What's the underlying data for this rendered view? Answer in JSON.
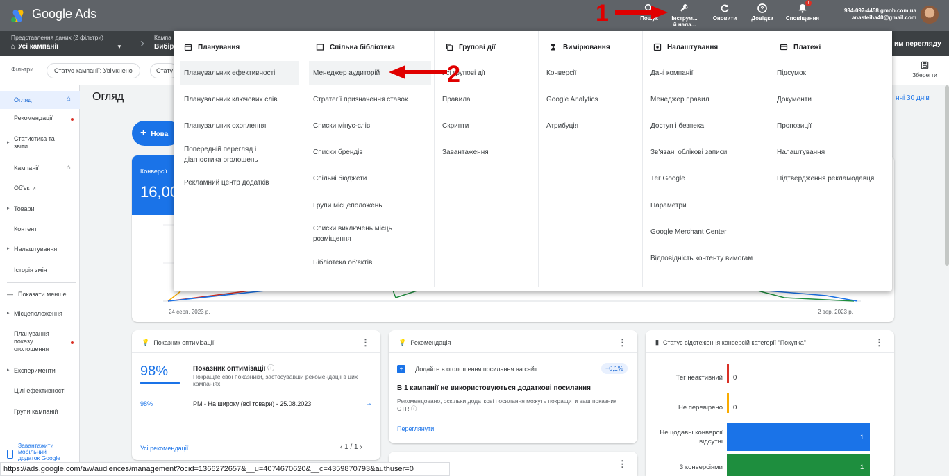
{
  "app": {
    "name": "Google Ads"
  },
  "header": {
    "tools": [
      {
        "label": "Пошук",
        "icon": "search-icon"
      },
      {
        "label": "Інструм... й нала...",
        "icon": "wrench-icon"
      },
      {
        "label": "Оновити",
        "icon": "refresh-icon"
      },
      {
        "label": "Довідка",
        "icon": "help-icon"
      },
      {
        "label": "Сповіщення",
        "icon": "bell-icon",
        "badge": "!"
      }
    ],
    "account_id": "934-097-4458 gmob.com.ua",
    "account_email": "anasteiha40@gmail.com"
  },
  "subbar": {
    "view_label": "Представлення даних (2 фільтри)",
    "view_value": "Усі кампанії",
    "campaign_label": "Кампа",
    "campaign_value": "Вибір",
    "right_text": "им перегляду"
  },
  "filters": {
    "label": "Фільтри",
    "chips": [
      "Статус кампанії: Увімкнено",
      "Стату"
    ],
    "save_label": "Зберегти"
  },
  "sidebar": {
    "items": [
      {
        "label": "Огляд",
        "active": true,
        "home": true
      },
      {
        "label": "Рекомендації",
        "dot": true
      },
      {
        "label": "Статистика та звіти",
        "caret": true
      },
      {
        "label": "Кампанії",
        "home": true
      },
      {
        "label": "Об'єкти"
      },
      {
        "label": "Товари",
        "caret": true
      },
      {
        "label": "Контент"
      },
      {
        "label": "Налаштування",
        "caret": true
      },
      {
        "label": "Історія змін"
      },
      {
        "label": "Показати менше"
      },
      {
        "label": "Місцеположення",
        "caret": true
      },
      {
        "label": "Планування показу оголошення",
        "dot": true
      },
      {
        "label": "Експерименти",
        "caret": true
      },
      {
        "label": "Цілі ефективності"
      },
      {
        "label": "Групи кампаній"
      },
      {
        "label": "Завантажити мобільний додаток Google"
      }
    ]
  },
  "main": {
    "title": "Огляд",
    "date_range": "нні 30 днів",
    "new_button": "Нова",
    "kpi_label": "Конверсії",
    "kpi_value": "16,00",
    "axis_start": "24 серп. 2023 р.",
    "axis_end": "2 вер. 2023 р."
  },
  "mega_menu": {
    "columns": [
      {
        "title": "Планування",
        "icon": "calendar-icon",
        "items": [
          "Планувальник ефективності",
          "Планувальник ключових слів",
          "Планувальник охоплення",
          "Попередній перегляд і діагностика оголошень",
          "Рекламний центр додатків"
        ]
      },
      {
        "title": "Спільна бібліотека",
        "icon": "library-icon",
        "items": [
          "Менеджер аудиторій",
          "Стратегії призначення ставок",
          "Списки мінус-слів",
          "Списки брендів",
          "Спільні бюджети",
          "Групи місцеположень",
          "Списки виключень місць розміщення",
          "Бібліотека об'єктів"
        ]
      },
      {
        "title": "Групові дії",
        "icon": "copy-icon",
        "items": [
          "Усі групові дії",
          "Правила",
          "Скрипти",
          "Завантаження"
        ]
      },
      {
        "title": "Вимірювання",
        "icon": "hourglass-icon",
        "items": [
          "Конверсії",
          "Google Analytics",
          "Атрибуція"
        ]
      },
      {
        "title": "Налаштування",
        "icon": "settings-icon",
        "items": [
          "Дані компанії",
          "Менеджер правил",
          "Доступ і безпека",
          "Зв'язані облікові записи",
          "Тег Google",
          "Параметри",
          "Google Merchant Center",
          "Відповідність контенту вимогам"
        ]
      },
      {
        "title": "Платежі",
        "icon": "card-icon",
        "items": [
          "Підсумок",
          "Документи",
          "Пропозиції",
          "Налаштування",
          "Підтвердження рекламодавця"
        ]
      }
    ]
  },
  "annotations": {
    "one": "1",
    "two": "2"
  },
  "cards": {
    "opt": {
      "title": "Показник оптимізації",
      "score": "98%",
      "score_fraction": 0.98,
      "heading": "Показник оптимізації",
      "desc": "Покращте свої показники, застосувавши рекомендації в цих кампаніях",
      "row_pct": "98%",
      "row_name": "PM - На широку (всі товари) - 25.08.2023",
      "link": "Усі рекомендації",
      "pager": "1 / 1"
    },
    "rec": {
      "title": "Рекомендація",
      "sub": "Додайте в оголошення посилання на сайт",
      "badge": "+0,1%",
      "heading": "В 1 кампанії не використовуються додаткові посилання",
      "desc": "Рекомендовано, оскільки додаткові посилання можуть покращити ваш показник CTR",
      "link": "Переглянути"
    },
    "conv": {
      "title": "Статус відстеження конверсій категорії \"Покупка\"",
      "rows": [
        {
          "label": "Тег неактивний",
          "value": "0",
          "color": "#d93025"
        },
        {
          "label": "Не перевірено",
          "value": "0",
          "color": "#f9ab00"
        },
        {
          "label": "Нещодавні конверсії відсутні",
          "value": "1",
          "color": "#1a73e8"
        },
        {
          "label": "З конверсіями",
          "value": "1",
          "color": "#1e8e3e"
        }
      ]
    }
  },
  "statusbar": {
    "url": "https://ads.google.com/aw/audiences/management?ocid=1366272657&__u=4074670620&__c=4359870793&authuser=0"
  }
}
